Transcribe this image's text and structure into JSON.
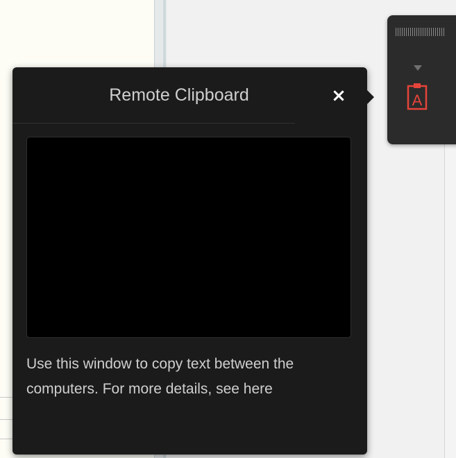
{
  "popup": {
    "title": "Remote Clipboard",
    "close_symbol": "×",
    "clipboard_value": "",
    "help_text_before_link": "Use this window to copy text between the computers. For more details, see",
    "help_link_label": "here"
  },
  "toolbar": {
    "icons": [
      "grip-handle-icon",
      "dropdown-arrow-icon",
      "clipboard-icon"
    ],
    "clipboard_icon_letter": "A",
    "accent_color": "#e5443a"
  },
  "colors": {
    "popup_background": "#1b1b1b",
    "clipboard_background": "#000000",
    "toolbar_background": "#2b2b2b"
  }
}
